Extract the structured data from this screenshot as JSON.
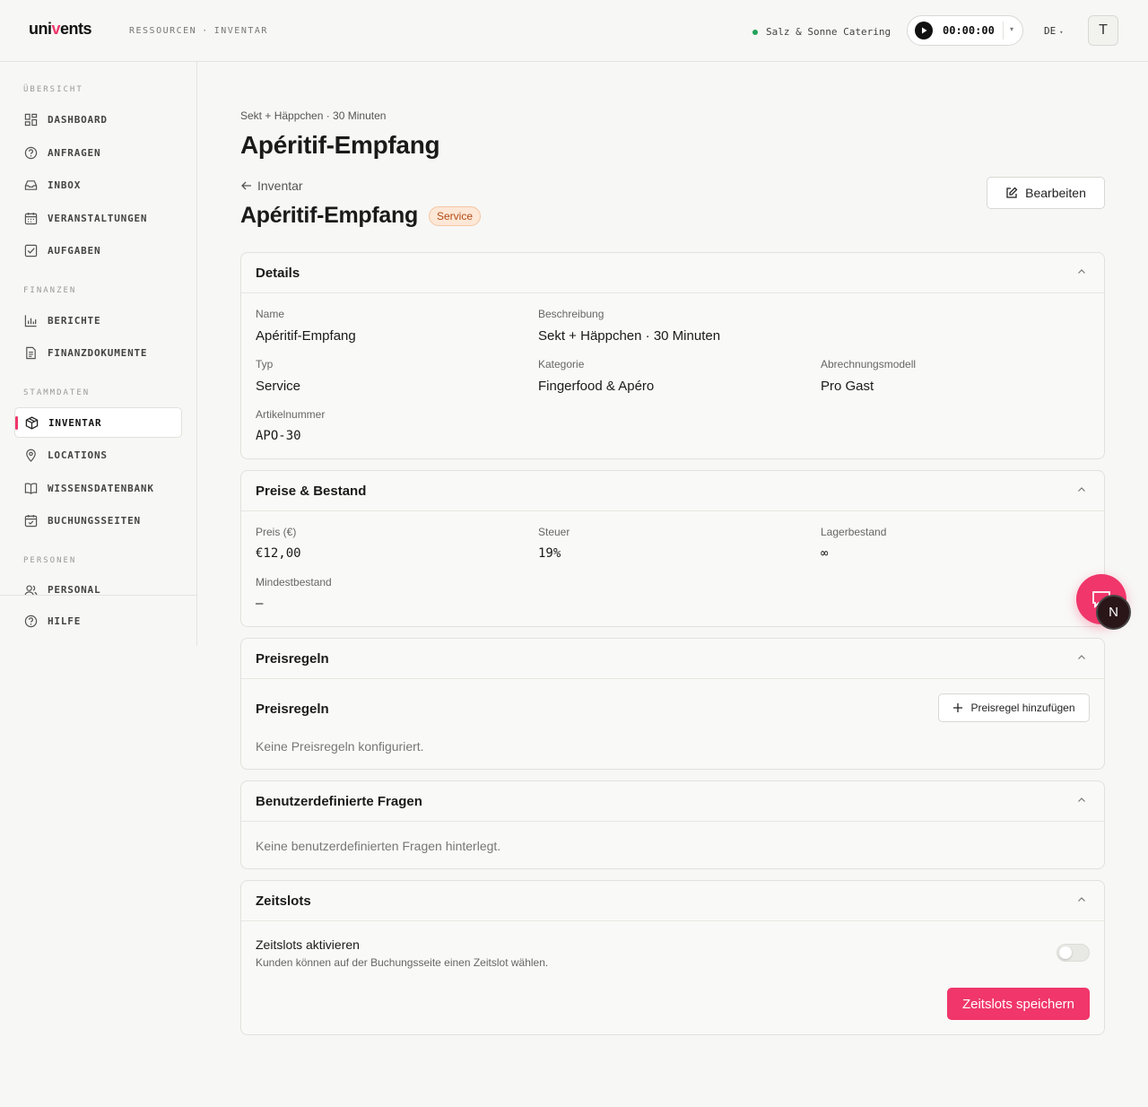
{
  "header": {
    "logo_pre": "uni",
    "logo_accent": "v",
    "logo_post": "ents",
    "breadcrumb": [
      "RESSOURCEN",
      "INVENTAR"
    ],
    "breadcrumb_sep": "·",
    "organization": "Salz & Sonne Catering",
    "organization_status_color": "#22a35a",
    "timer": "00:00:00",
    "language": "DE",
    "avatar_initial": "T"
  },
  "sidebar": {
    "sections": {
      "overview": "ÜBERSICHT",
      "finance": "FINANZEN",
      "masterdata": "STAMMDATEN",
      "people": "PERSONEN"
    },
    "items": {
      "dashboard": "DASHBOARD",
      "anfragen": "ANFRAGEN",
      "inbox": "INBOX",
      "veranstaltungen": "VERANSTALTUNGEN",
      "aufgaben": "AUFGABEN",
      "berichte": "BERICHTE",
      "finanzdokumente": "FINANZDOKUMENTE",
      "inventar": "INVENTAR",
      "locations": "LOCATIONS",
      "wissensdatenbank": "WISSENSDATENBANK",
      "buchungsseiten": "BUCHUNGSSEITEN",
      "personal": "PERSONAL",
      "hilfe": "HILFE"
    },
    "active_item": "INVENTAR"
  },
  "page": {
    "kicker": "Sekt + Häppchen · 30 Minuten",
    "title": "Apéritif-Empfang",
    "back_label": "Inventar",
    "item_title": "Apéritif-Empfang",
    "badge": "Service",
    "edit_label": "Bearbeiten"
  },
  "details": {
    "heading": "Details",
    "name_label": "Name",
    "name": "Apéritif-Empfang",
    "description_label": "Beschreibung",
    "description": "Sekt + Häppchen · 30 Minuten",
    "type_label": "Typ",
    "type": "Service",
    "category_label": "Kategorie",
    "category": "Fingerfood & Apéro",
    "billing_label": "Abrechnungsmodell",
    "billing": "Pro Gast",
    "sku_label": "Artikelnummer",
    "sku": "APO-30"
  },
  "pricing": {
    "heading": "Preise & Bestand",
    "price_label": "Preis (€)",
    "price": "€12,00",
    "tax_label": "Steuer",
    "tax": "19%",
    "stock_label": "Lagerbestand",
    "stock": "∞",
    "min_stock_label": "Mindestbestand",
    "min_stock": "—"
  },
  "price_rules": {
    "heading": "Preisregeln",
    "subheading": "Preisregeln",
    "add_label": "Preisregel hinzufügen",
    "empty": "Keine Preisregeln konfiguriert."
  },
  "custom_questions": {
    "heading": "Benutzerdefinierte Fragen",
    "empty": "Keine benutzerdefinierten Fragen hinterlegt."
  },
  "timeslots": {
    "heading": "Zeitslots",
    "toggle_label": "Zeitslots aktivieren",
    "toggle_hint": "Kunden können auf der Buchungsseite einen Zeitslot wählen.",
    "enabled": false,
    "save_label": "Zeitslots speichern"
  },
  "floating": {
    "assistant_initial": "N"
  },
  "colors": {
    "accent": "#f0366a",
    "badge_bg": "#fde7d6",
    "badge_text": "#b24a14"
  }
}
